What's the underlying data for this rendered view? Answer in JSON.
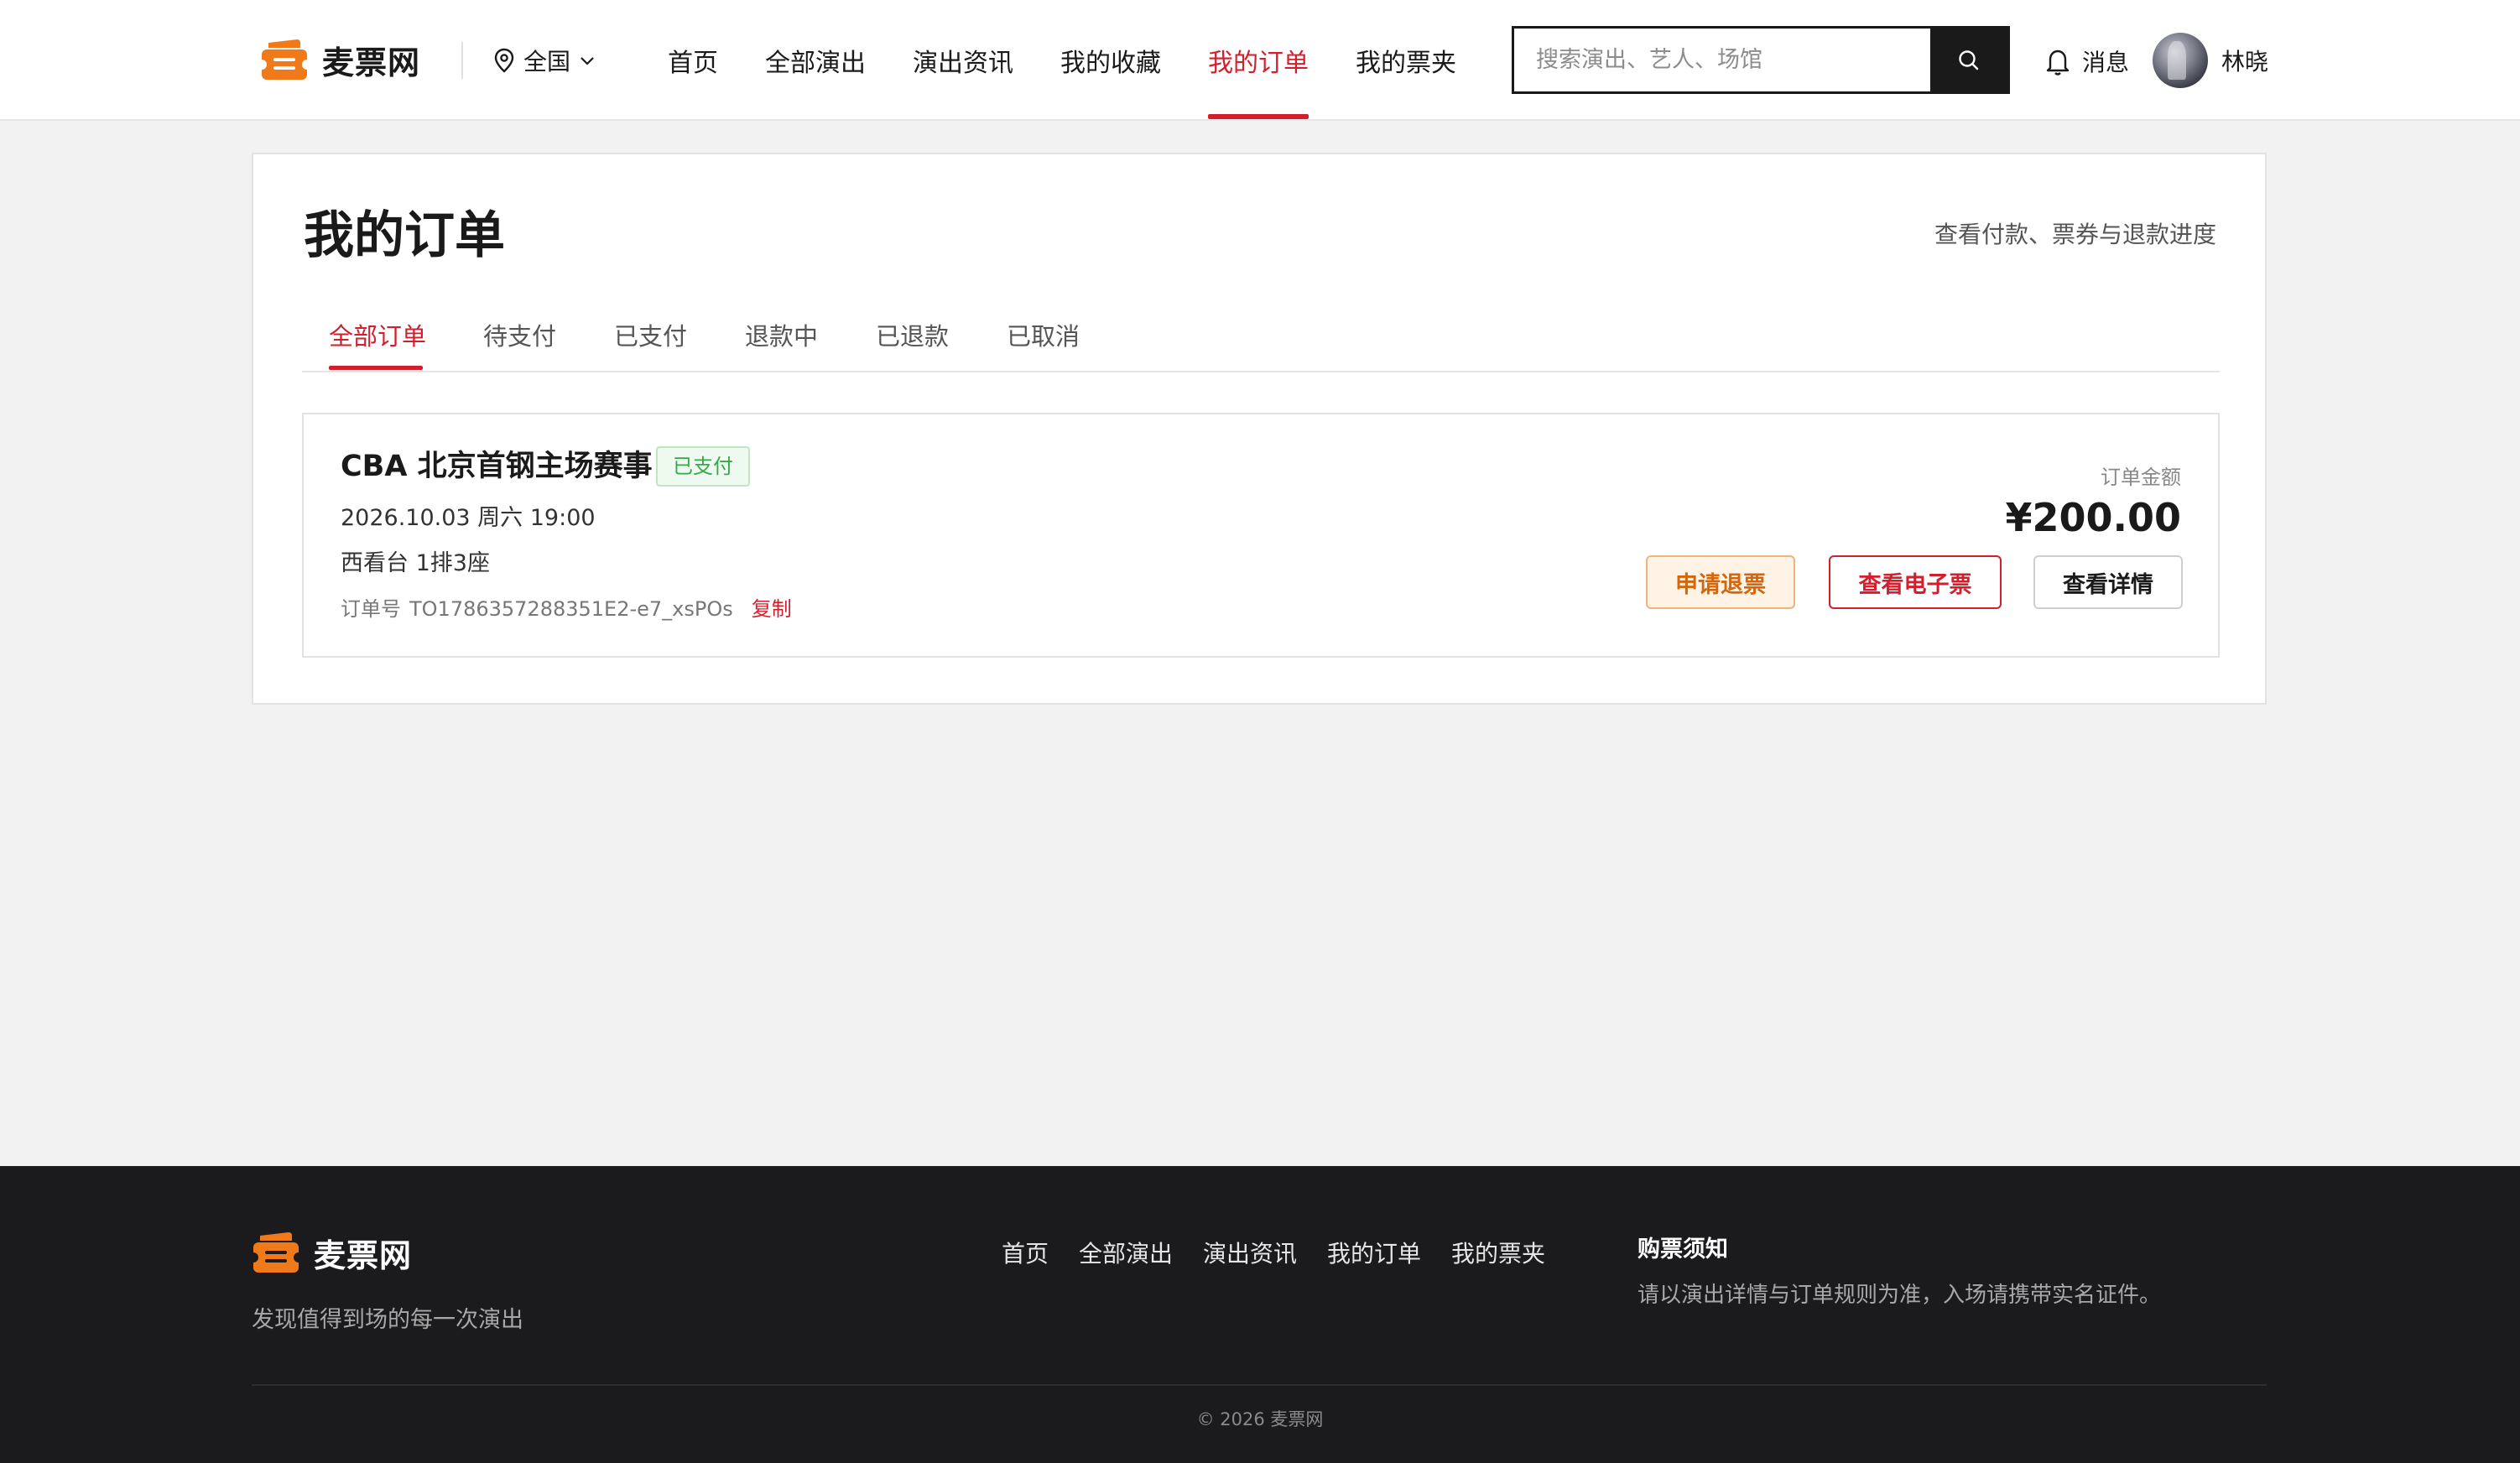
{
  "brand": {
    "name": "麦票网",
    "accent_color": "#d21f2d",
    "logo_color": "#f07a1a"
  },
  "header": {
    "city": "全国",
    "nav": [
      {
        "label": "首页",
        "active": false
      },
      {
        "label": "全部演出",
        "active": false
      },
      {
        "label": "演出资讯",
        "active": false
      },
      {
        "label": "我的收藏",
        "active": false
      },
      {
        "label": "我的订单",
        "active": true
      },
      {
        "label": "我的票夹",
        "active": false
      }
    ],
    "search_placeholder": "搜索演出、艺人、场馆",
    "search_value": "",
    "messages_label": "消息",
    "user_name": "林晓"
  },
  "page": {
    "title": "我的订单",
    "hint": "查看付款、票券与退款进度",
    "tabs": [
      {
        "label": "全部订单",
        "active": true
      },
      {
        "label": "待支付",
        "active": false
      },
      {
        "label": "已支付",
        "active": false
      },
      {
        "label": "退款中",
        "active": false
      },
      {
        "label": "已退款",
        "active": false
      },
      {
        "label": "已取消",
        "active": false
      }
    ]
  },
  "orders": [
    {
      "title": "CBA 北京首钢主场赛事",
      "status": "已支付",
      "datetime": "2026.10.03 周六 19:00",
      "seat": "西看台 1排3座",
      "order_no_label": "订单号",
      "order_no": "TO1786357288351E2-e7_xsPOs",
      "copy_label": "复制",
      "amount_label": "订单金额",
      "amount": "¥200.00",
      "actions": {
        "refund": "申请退票",
        "eticket": "查看电子票",
        "detail": "查看详情"
      }
    }
  ],
  "footer": {
    "slogan": "发现值得到场的每一次演出",
    "links": [
      "首页",
      "全部演出",
      "演出资讯",
      "我的订单",
      "我的票夹"
    ],
    "notice_title": "购票须知",
    "notice_text": "请以演出详情与订单规则为准，入场请携带实名证件。",
    "copyright": "© 2026 麦票网"
  }
}
